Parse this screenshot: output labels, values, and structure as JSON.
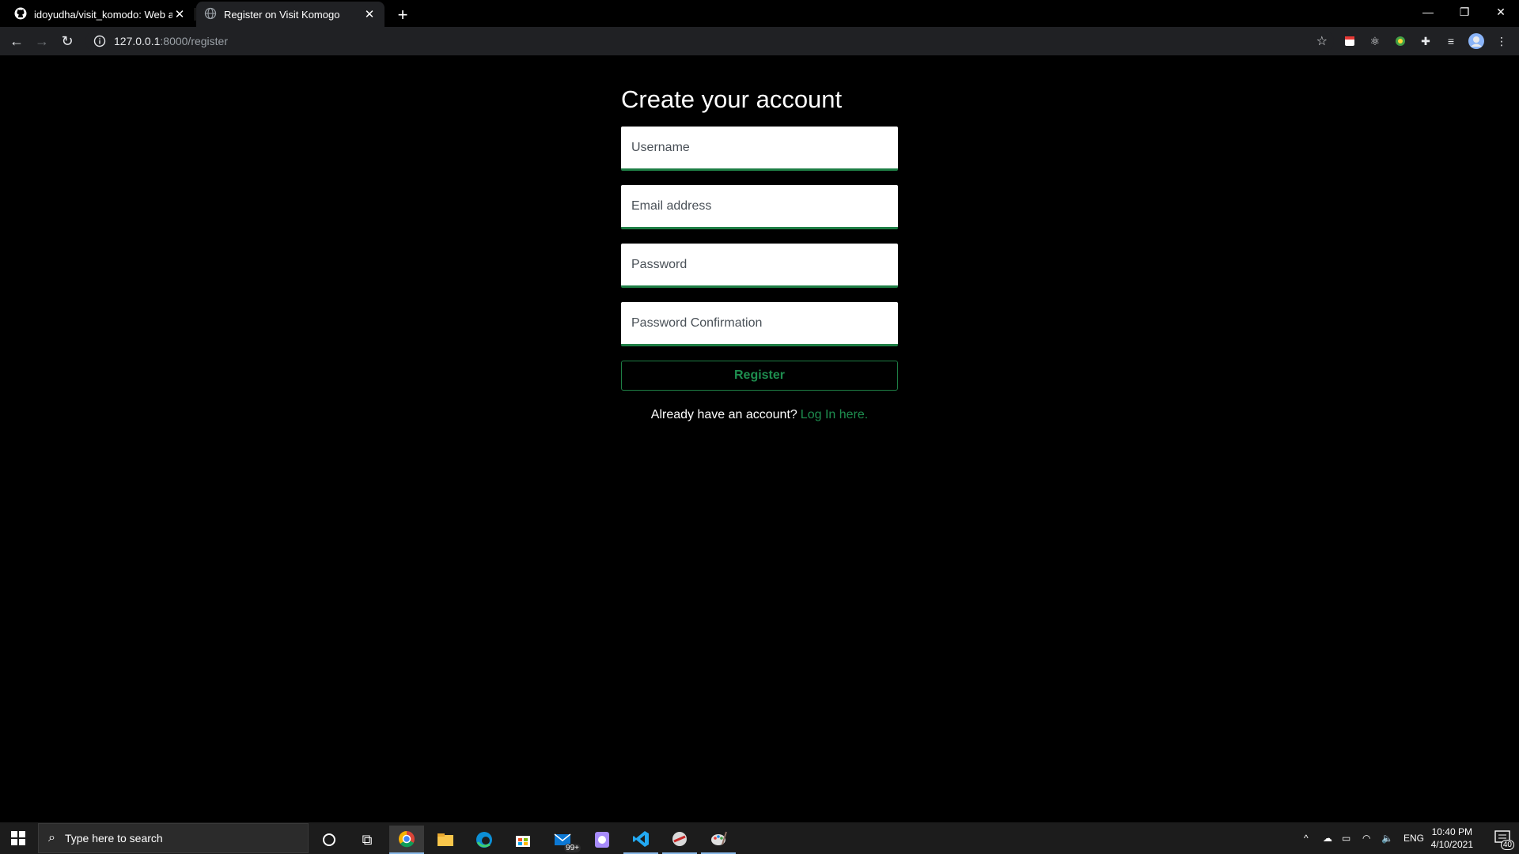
{
  "browser": {
    "tabs": [
      {
        "title": "idoyudha/visit_komodo: Web app",
        "icon": "github-icon"
      },
      {
        "title": "Register on Visit Komogo",
        "icon": "globe-icon"
      }
    ],
    "url_host": "127.0.0.1",
    "url_rest": ":8000/register"
  },
  "form": {
    "heading": "Create your account",
    "username_placeholder": "Username",
    "email_placeholder": "Email address",
    "password_placeholder": "Password",
    "password_confirm_placeholder": "Password Confirmation",
    "register_label": "Register",
    "login_prompt": "Already have an account?",
    "login_link": "Log In here."
  },
  "taskbar": {
    "search_placeholder": "Type here to search",
    "mail_badge": "99+",
    "language": "ENG",
    "time": "10:40 PM",
    "date": "4/10/2021",
    "notification_count": "40"
  },
  "colors": {
    "accent": "#1e8e4f",
    "background": "#000000"
  }
}
